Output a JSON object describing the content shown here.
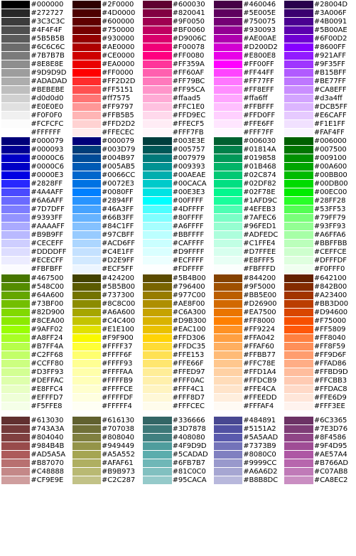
{
  "blocks": [
    {
      "columns": [
        [
          "#000000",
          "#272727",
          "#3C3C3C",
          "#4F4F4F",
          "#5B5B5B",
          "#6C6C6C",
          "#7B7B7B",
          "#8E8E8E",
          "#9D9D9D",
          "#ADADAD",
          "#BEBEBE",
          "#d0d0d0",
          "#E0E0E0",
          "#F0F0F0",
          "#FCFCFC",
          "#FFFFFF"
        ],
        [
          "#2F0000",
          "#4D0000",
          "#600000",
          "#750000",
          "#930000",
          "#AE0000",
          "#CE0000",
          "#EA0000",
          "#FF0000",
          "#FF2D2D",
          "#FF5151",
          "#ff7575",
          "#FF9797",
          "#FFB5B5",
          "#FFD2D2",
          "#FFECEC"
        ],
        [
          "#600030",
          "#820041",
          "#9F0050",
          "#BF0060",
          "#D9006C",
          "#F00078",
          "#FF0080",
          "#FF359A",
          "#FF60AF",
          "#FF79BC",
          "#FF95CA",
          "#ffaad5",
          "#FFC1E0",
          "#FFD9EC",
          "#FFECF5",
          "#FFF7FB"
        ],
        [
          "#460046",
          "#5E005E",
          "#750075",
          "#930093",
          "#AE00AE",
          "#D200D2",
          "#E800E8",
          "#FF00FF",
          "#FF44FF",
          "#FF77FF",
          "#FF8EFF",
          "#ffa6ff",
          "#FFBFFF",
          "#FFD0FF",
          "#FFE6FF",
          "#FFF7FF"
        ],
        [
          "#28004D",
          "#3A006F",
          "#4B0091",
          "#5B00AE",
          "#6F00D2",
          "#8600FF",
          "#921AFF",
          "#9F35FF",
          "#B15BFF",
          "#BE77FF",
          "#CA8EFF",
          "#d3a4ff",
          "#DCB5FF",
          "#E6CAFF",
          "#F1E1FF",
          "#FAF4FF"
        ]
      ]
    },
    {
      "columns": [
        [
          "#000079",
          "#000093",
          "#0000C6",
          "#0000C6",
          "#0000E3",
          "#2828FF",
          "#4A4AFF",
          "#6A6AFF",
          "#7D7DFF",
          "#9393FF",
          "#AAAAFF",
          "#B9B9FF",
          "#CECEFF",
          "#DDDDFF",
          "#ECECFF",
          "#FBFBFF"
        ],
        [
          "#000079",
          "#003D79",
          "#004B97",
          "#005AB5",
          "#0066CC",
          "#0072E3",
          "#0080FF",
          "#2894FF",
          "#46A3FF",
          "#66B3FF",
          "#84C1FF",
          "#97CBFF",
          "#ACD6FF",
          "#C4E1FF",
          "#D2E9FF",
          "#ECF5FF"
        ],
        [
          "#003E3E",
          "#005757",
          "#007979",
          "#009393",
          "#00AEAE",
          "#00CACA",
          "#00E3E3",
          "#00FFFF",
          "#4DFFFF",
          "#80FFFF",
          "#A6FFFF",
          "#BBFFFF",
          "#CAFFFF",
          "#D9FFFF",
          "#ECFFFF",
          "#FDFFFF"
        ],
        [
          "#006030",
          "#01814A",
          "#019858",
          "#01B468",
          "#02C874",
          "#02DF82",
          "#02F78E",
          "#1AFD9C",
          "#4EFEB3",
          "#7AFEC6",
          "#96FED1",
          "#ADFEDC",
          "#C1FFE4",
          "#D7FFEE",
          "#E8FFF5",
          "#FBFFFD"
        ],
        [
          "#006000",
          "#007500",
          "#009100",
          "#00A600",
          "#00BB00",
          "#00DB00",
          "#00EC00",
          "#28FF28",
          "#53FF53",
          "#79FF79",
          "#93FF93",
          "#A6FFA6",
          "#BBFFBB",
          "#CEFFCE",
          "#DFFFDF",
          "#F0FFF0"
        ]
      ]
    },
    {
      "columns": [
        [
          "#467500",
          "#548C00",
          "#64A600",
          "#73BF00",
          "#82D900",
          "#8CEA00",
          "#9AFF02",
          "#A8FF24",
          "#B7FF4A",
          "#C2FF68",
          "#CCFF80",
          "#D3FF93",
          "#DEFFAC",
          "#E8FFC4",
          "#EFFFD7",
          "#F5FFE8"
        ],
        [
          "#424200",
          "#5B5B00",
          "#737300",
          "#8C8C00",
          "#A6A600",
          "#C4C400",
          "#E1E100",
          "#F9F900",
          "#FFFF37",
          "#FFFF6F",
          "#FFFF93",
          "#FFFFAA",
          "#FFFFB9",
          "#FFFFCE",
          "#FFFFDF",
          "#FFFFF4"
        ],
        [
          "#5B4B00",
          "#796400",
          "#977C00",
          "#AE8F00",
          "#C6A300",
          "#D9B300",
          "#EAC100",
          "#FFD306",
          "#FFDC35",
          "#FFE153",
          "#FFE66F",
          "#FFED97",
          "#FFF0AC",
          "#FFF4C1",
          "#FFF8D7",
          "#FFFCEC"
        ],
        [
          "#844200",
          "#9F5000",
          "#BB5E00",
          "#D26900",
          "#EA7500",
          "#FF8000",
          "#FF9224",
          "#FFA042",
          "#FFAF60",
          "#FFBB77",
          "#FFC78E",
          "#FFD1A4",
          "#FFDCB9",
          "#FFE4CA",
          "#FFEEDD",
          "#FFFAF4"
        ],
        [
          "#642100",
          "#842B00",
          "#A23400",
          "#BB3D00",
          "#D94600",
          "#F75000",
          "#FF5809",
          "#FF8040",
          "#FF8F59",
          "#FF9D6F",
          "#FFAD86",
          "#FFBD9D",
          "#FFCBB3",
          "#FFDAC8",
          "#FFE6D9",
          "#FFF3EE"
        ]
      ]
    },
    {
      "columns": [
        [
          "#613030",
          "#743A3A",
          "#804040",
          "#984B4B",
          "#AD5A5A",
          "#B87070",
          "#C48888",
          "#CF9E9E"
        ],
        [
          "#616130",
          "#707038",
          "#808040",
          "#949449",
          "#A5A552",
          "#AFAF61",
          "#B9B973",
          "#C2C287"
        ],
        [
          "#336666",
          "#3D7878",
          "#408080",
          "#4F9D9D",
          "#5CADAD",
          "#6FB7B7",
          "#81C0C0",
          "#95CACA"
        ],
        [
          "#484891",
          "#5151A2",
          "#5A5AAD",
          "#7373B9",
          "#8080C0",
          "#9999CC",
          "#A6A6D2",
          "#B8B8DC"
        ],
        [
          "#6C3365",
          "#7E3D76",
          "#8F4586",
          "#9F4D95",
          "#AE57A4",
          "#B766AD",
          "#C07AB8",
          "#CA8EC2"
        ]
      ]
    }
  ]
}
